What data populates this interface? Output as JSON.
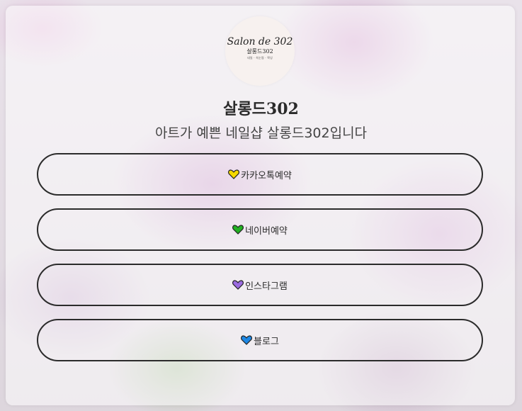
{
  "profile": {
    "logo_line1": "Salon de 302",
    "logo_line2": "살롱드302",
    "logo_line3": "네일 · 속눈썹 · 왁싱",
    "title": "살롱드302",
    "subtitle": "아트가 예쁜 네일샵 살롱드302입니다"
  },
  "links": [
    {
      "label": "카카오톡예약",
      "heart_color": "#f5d800",
      "icon": "yellow-heart-icon"
    },
    {
      "label": "네이버예약",
      "heart_color": "#22b022",
      "icon": "green-heart-icon"
    },
    {
      "label": "인스타그램",
      "heart_color": "#9b6be0",
      "icon": "purple-heart-icon"
    },
    {
      "label": "블로그",
      "heart_color": "#1e88e5",
      "icon": "blue-heart-icon"
    }
  ]
}
